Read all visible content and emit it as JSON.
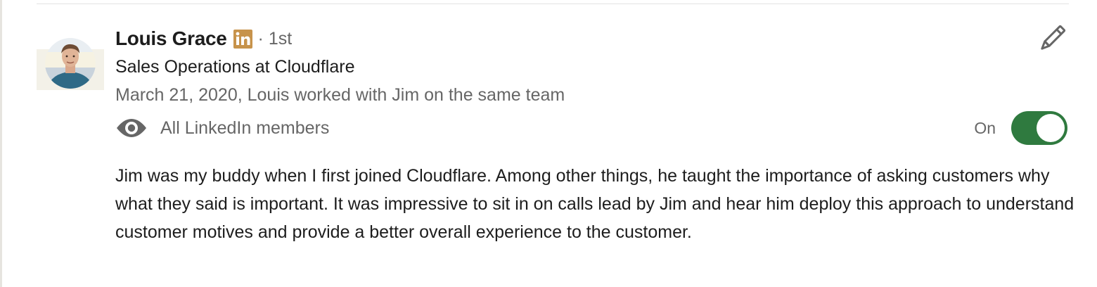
{
  "recommendation": {
    "name": "Louis Grace",
    "badge_icon": "linkedin-icon",
    "degree": "· 1st",
    "headline": "Sales Operations at Cloudflare",
    "meta": "March 21, 2020, Louis worked with Jim on the same team",
    "visibility_icon": "eye-icon",
    "visibility_label": "All LinkedIn members",
    "toggle_label": "On",
    "toggle_on": true,
    "edit_icon": "pencil-icon",
    "text": "Jim was my buddy when I first joined Cloudflare. Among other things, he taught the importance of asking customers why what they said is important. It was impressive to sit in on calls lead by Jim and hear him deploy this approach to understand customer motives and provide a better overall experience to the customer."
  },
  "colors": {
    "toggle_on": "#2f7a3f",
    "linkedin_badge": "#c7934b",
    "text_primary": "#1d1d1d",
    "text_secondary": "#666666"
  }
}
